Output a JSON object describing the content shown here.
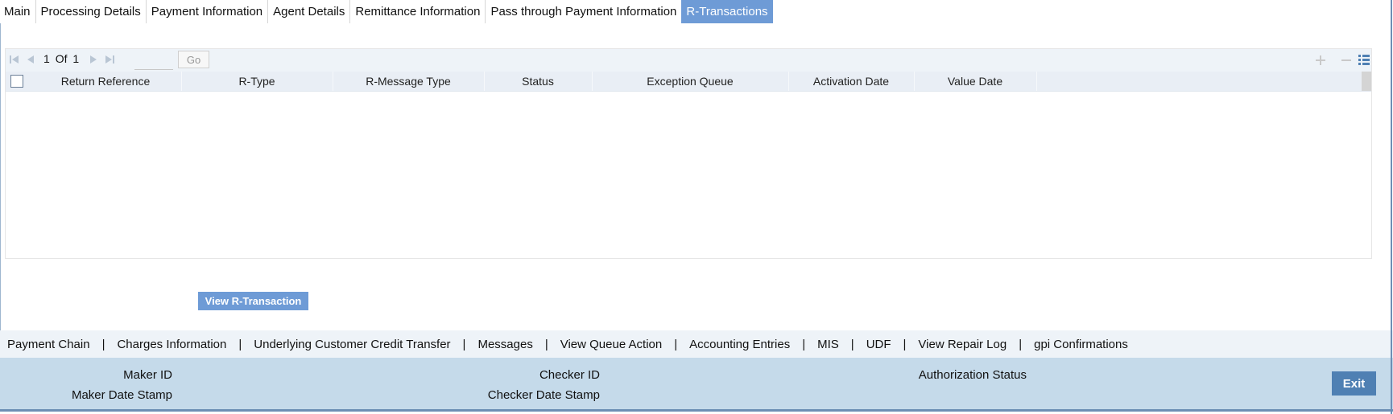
{
  "tabs": [
    {
      "label": "Main",
      "active": false
    },
    {
      "label": "Processing Details",
      "active": false
    },
    {
      "label": "Payment Information",
      "active": false
    },
    {
      "label": "Agent Details",
      "active": false
    },
    {
      "label": "Remittance Information",
      "active": false
    },
    {
      "label": "Pass through Payment Information",
      "active": false
    },
    {
      "label": "R-Transactions",
      "active": true
    }
  ],
  "pager": {
    "current": "1",
    "of_label": "Of",
    "total": "1",
    "go_label": "Go",
    "page_input_value": ""
  },
  "grid": {
    "columns": [
      "Return Reference",
      "R-Type",
      "R-Message Type",
      "Status",
      "Exception Queue",
      "Activation Date",
      "Value Date"
    ],
    "rows": []
  },
  "toolbar_icons": [
    "add-row-icon",
    "delete-row-icon",
    "single-view-icon"
  ],
  "view_button": "View R-Transaction",
  "links": [
    "Payment Chain",
    "Charges Information",
    "Underlying Customer Credit Transfer",
    "Messages",
    "View Queue Action",
    "Accounting Entries",
    "MIS",
    "UDF",
    "View Repair Log",
    "gpi Confirmations"
  ],
  "link_separator": "|",
  "audit": {
    "maker_id": "Maker ID",
    "maker_date_stamp": "Maker Date Stamp",
    "checker_id": "Checker ID",
    "checker_date_stamp": "Checker Date Stamp",
    "authorization_status": "Authorization Status"
  },
  "exit_label": "Exit",
  "colors": {
    "active_tab": "#6e9bd6",
    "footer_bg": "#c5daea",
    "exit_button": "#4f80b3",
    "header_row": "#e9eef5"
  }
}
